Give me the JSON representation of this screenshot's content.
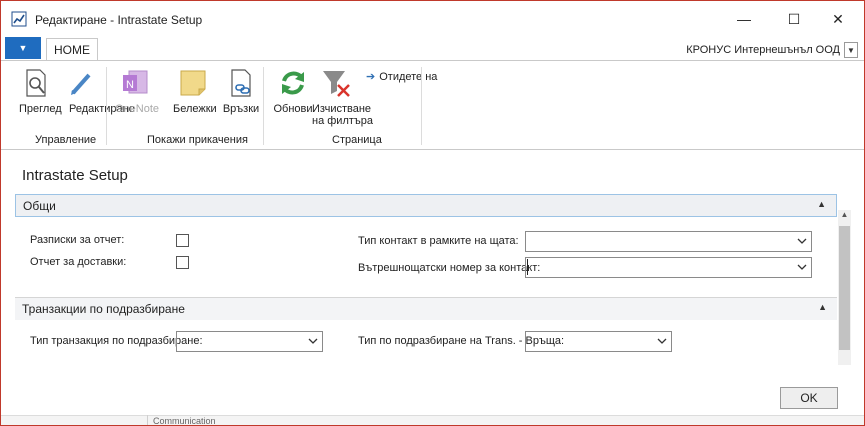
{
  "window": {
    "title": "Редактиране - Intrastate Setup",
    "controls": {
      "minimize": "—",
      "maximize": "☐",
      "close": "✕"
    }
  },
  "ribbon_tabs": {
    "file_arrow": "▼",
    "home": "HOME"
  },
  "company": {
    "name": "КРОНУС Интернешънъл ООД"
  },
  "ribbon": {
    "buttons": {
      "view": "Преглед",
      "edit": "Редактиране",
      "onenote": "OneNote",
      "notes": "Бележки",
      "links": "Връзки",
      "refresh": "Обнови",
      "clear_filter_line1": "Изчистване",
      "clear_filter_line2": "на филтъра",
      "go_to": "Отидете на"
    },
    "groups": {
      "manage": "Управление",
      "show_attached": "Покажи прикачения",
      "page": "Страница"
    }
  },
  "page": {
    "title": "Intrastate Setup"
  },
  "sections": {
    "general": {
      "title": "Общи",
      "fields": {
        "report_receipts": "Разписки за отчет:",
        "report_shipments": "Отчет за доставки:",
        "contact_type": "Тип контакт в рамките на щата:",
        "contact_no": "Вътрешнощатски номер за контакт:"
      },
      "values": {
        "contact_type": "",
        "contact_no": ""
      },
      "checkboxes": {
        "report_receipts": false,
        "report_shipments": false
      }
    },
    "default_transactions": {
      "title": "Транзакции по подразбиране",
      "fields": {
        "default_trans_type": "Тип транзакция по подразбиране:",
        "default_trans_return": "Тип по подразбиране на Trans. - Връща:"
      },
      "values": {
        "default_trans_type": "",
        "default_trans_return": ""
      }
    }
  },
  "buttons": {
    "ok": "OK"
  },
  "background": {
    "text": "Communication"
  },
  "colors": {
    "accent": "#1f6cbf",
    "frame": "#c0392b",
    "section_border": "#9cc3e5"
  }
}
